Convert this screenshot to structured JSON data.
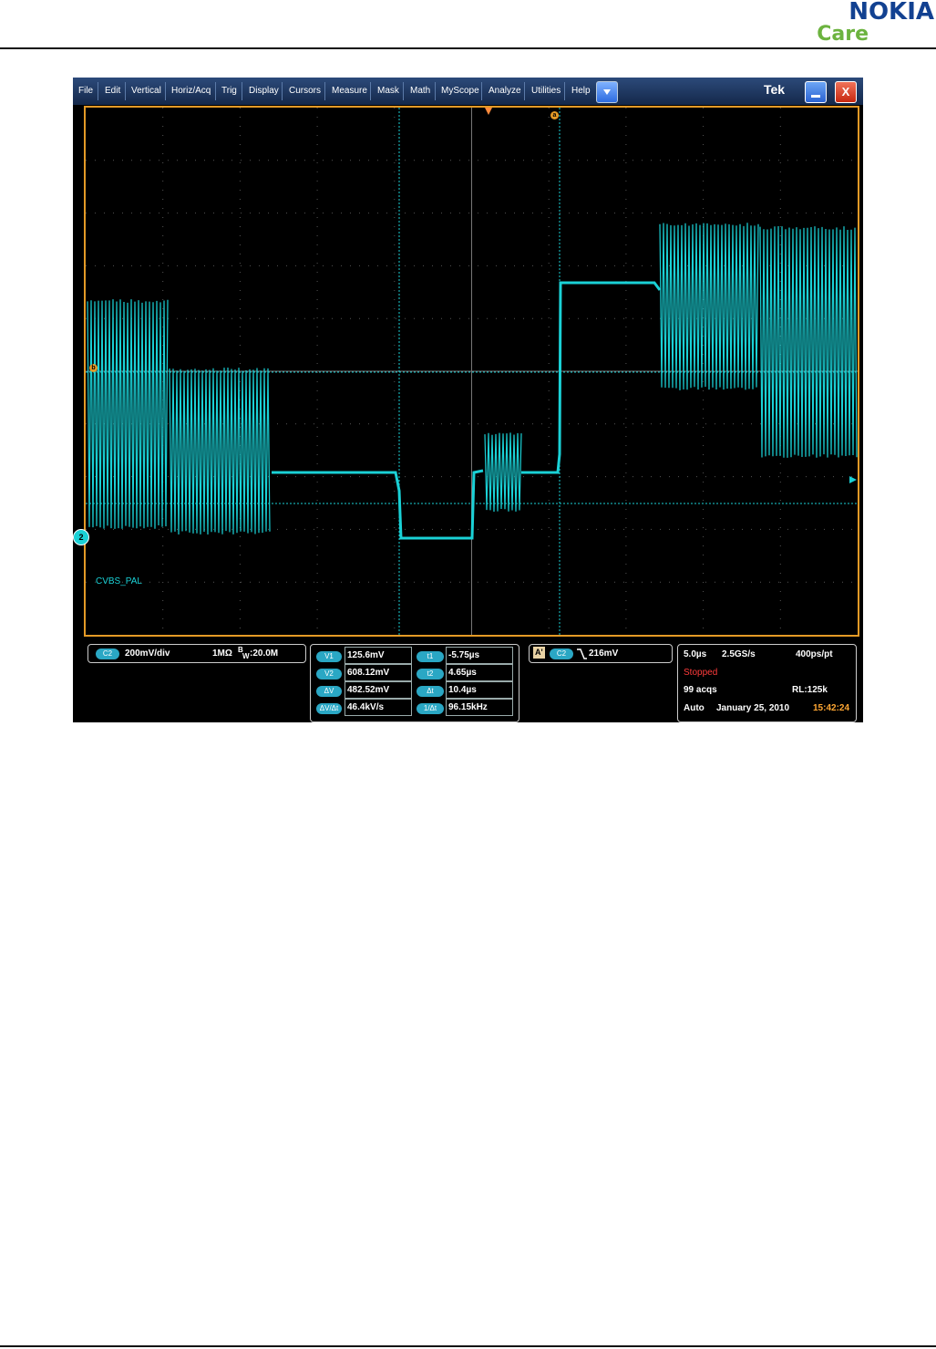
{
  "header": {
    "brand_line1": "NOKIA",
    "brand_line2": "Care"
  },
  "scope": {
    "menu": [
      "File",
      "Edit",
      "Vertical",
      "Horiz/Acq",
      "Trig",
      "Display",
      "Cursors",
      "Measure",
      "Mask",
      "Math",
      "MyScope",
      "Analyze",
      "Utilities",
      "Help"
    ],
    "menu_dropdown_icon": "triangle-down-icon",
    "brand": "Tek",
    "minimize_icon": "minimize-icon",
    "close_label": "X",
    "trace_label": "CVBS_PAL",
    "channel_marker": "2",
    "cursor_a_marker": "a",
    "cursor_b_marker": "b",
    "waveform_color": "#1ad1d6",
    "graticule_color": "#e49a26"
  },
  "channel": {
    "badge": "C2",
    "scale": "200mV/div",
    "impedance": "1MΩ",
    "bw_prefix": "B",
    "bw_sub": "W",
    "bandwidth": ":20.0M"
  },
  "cursors": {
    "v1_label": "V1",
    "v1_value": "125.6mV",
    "v2_label": "V2",
    "v2_value": "608.12mV",
    "dv_label": "ΔV",
    "dv_value": "482.52mV",
    "dvdt_label": "ΔV/Δt",
    "dvdt_value": "46.4kV/s",
    "t1_label": "t1",
    "t1_value": "-5.75µs",
    "t2_label": "t2",
    "t2_value": "4.65µs",
    "dt_label": "Δt",
    "dt_value": "10.4µs",
    "inv_dt_label": "1/Δt",
    "inv_dt_value": "96.15kHz"
  },
  "trigger": {
    "mode": "A'",
    "badge": "C2",
    "level": "216mV"
  },
  "acquisition": {
    "timebase": "5.0µs",
    "sample_rate": "2.5GS/s",
    "resolution": "400ps/pt",
    "status": "Stopped",
    "acqs": "99 acqs",
    "record_length": "RL:125k",
    "trigger_mode": "Auto",
    "date": "January 25, 2010",
    "time": "15:42:24",
    "status_color": "#ff3b3b",
    "time_color": "#ffa733"
  }
}
